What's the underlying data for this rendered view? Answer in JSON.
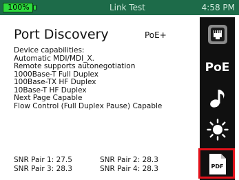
{
  "status_bar": {
    "battery": "100%",
    "title": "Link Test",
    "time": "4:58 PM",
    "battery_color": "#2ddc3c",
    "bar_color": "#1d6b49"
  },
  "main": {
    "title": "Port Discovery",
    "badge": "PoE+",
    "capabilities": [
      "Device capabilities:",
      "Automatic MDI/MDI_X.",
      "Remote supports autonegotiation",
      "1000Base-T Full Duplex",
      "100Base-TX HF Duplex",
      "10Base-T HF Duplex",
      "Next Page Capable",
      "Flow Control (Full Duplex Pause) Capable"
    ],
    "snr": [
      "SNR Pair 1: 27.5",
      "SNR Pair 2: 28.3",
      "SNR Pair 3: 28.3",
      "SNR Pair 4: 28.3"
    ]
  },
  "sidebar": {
    "items": [
      {
        "icon": "network-port-icon"
      },
      {
        "icon": "poe-icon",
        "label": "PoE"
      },
      {
        "icon": "music-note-icon"
      },
      {
        "icon": "brightness-icon"
      },
      {
        "icon": "pdf-icon",
        "label": "PDF"
      }
    ],
    "highlight_color": "#e3121b"
  }
}
